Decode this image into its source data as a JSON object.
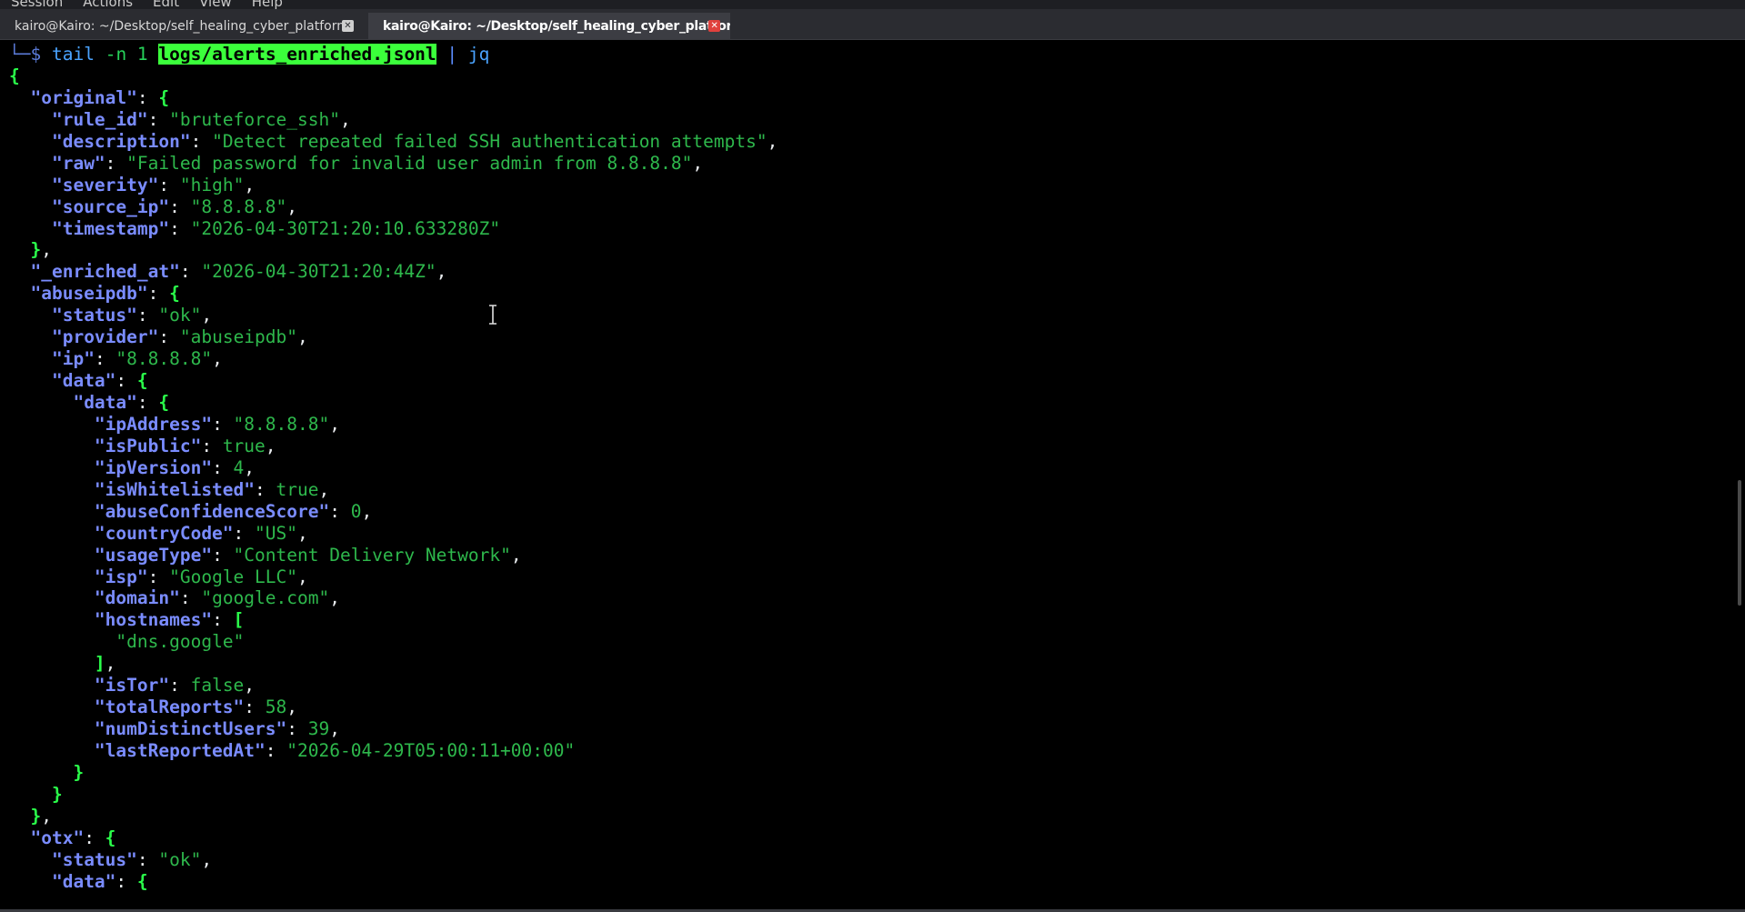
{
  "menubar": {
    "items": [
      "Session",
      "Actions",
      "Edit",
      "View",
      "Help"
    ]
  },
  "tabs": [
    {
      "title": "kairo@Kairo: ~/Desktop/self_healing_cyber_platform",
      "active": false
    },
    {
      "title": "kairo@Kairo: ~/Desktop/self_healing_cyber_platform",
      "active": true
    }
  ],
  "prompt": {
    "marker": "└─$",
    "command": "tail",
    "args": "-n 1",
    "file": "logs/alerts_enriched.jsonl",
    "pipe": "|",
    "tool": "jq"
  },
  "output": {
    "original": {
      "rule_id": "bruteforce_ssh",
      "description": "Detect repeated failed SSH authentication attempts",
      "raw": "Failed password for invalid user admin from 8.8.8.8",
      "severity": "high",
      "source_ip": "8.8.8.8",
      "timestamp": "2026-04-30T21:20:10.633280Z"
    },
    "_enriched_at": "2026-04-30T21:20:44Z",
    "abuseipdb": {
      "status": "ok",
      "provider": "abuseipdb",
      "ip": "8.8.8.8",
      "data": {
        "ipAddress": "8.8.8.8",
        "isPublic": "true",
        "ipVersion": "4",
        "isWhitelisted": "true",
        "abuseConfidenceScore": "0",
        "countryCode": "US",
        "usageType": "Content Delivery Network",
        "isp": "Google LLC",
        "domain": "google.com",
        "hostname_0": "dns.google",
        "isTor": "false",
        "totalReports": "58",
        "numDistinctUsers": "39",
        "lastReportedAt": "2026-04-29T05:00:11+00:00"
      }
    },
    "otx": {
      "status": "ok"
    }
  },
  "colors": {
    "background": "#000000",
    "key": "#7a8cff",
    "string": "#2eb84c",
    "bracket": "#2aff4a",
    "highlight": "#3bff3b",
    "tab_close_active": "#e0413d"
  }
}
